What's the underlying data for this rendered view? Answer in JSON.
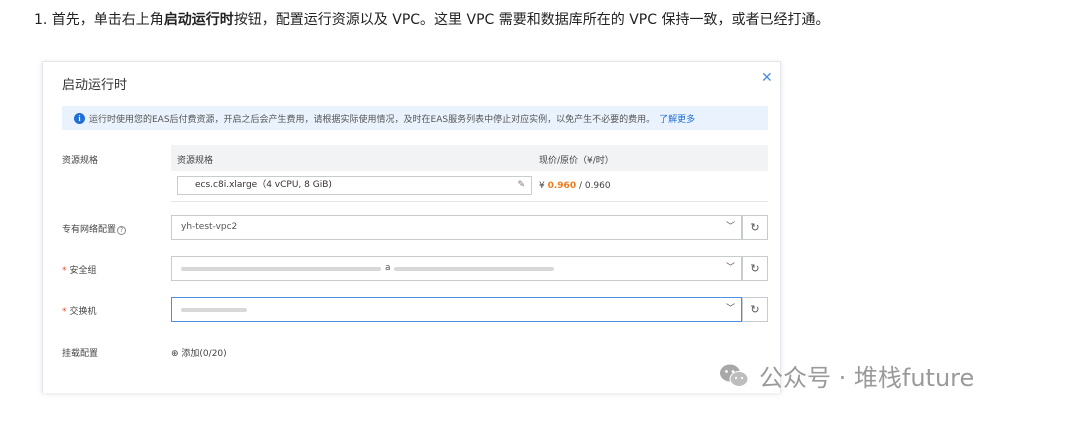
{
  "intro": {
    "prefix": "1. 首先，单击右上角",
    "bold": "启动运行时",
    "suffix": "按钮，配置运行资源以及 VPC。这里 VPC 需要和数据库所在的 VPC 保持一致，或者已经打通。"
  },
  "dialog": {
    "title": "启动运行时",
    "close_icon": "close-icon",
    "notice": {
      "icon": "info-icon",
      "text": "运行时使用您的EAS后付费资源，开启之后会产生费用，请根据实际使用情况，及时在EAS服务列表中停止对应实例，以免产生不必要的费用。",
      "link": "了解更多"
    },
    "spec": {
      "label": "资源规格",
      "col_spec": "资源规格",
      "col_price": "现价/原价（¥/时）",
      "value": "ecs.c8i.xlarge（4 vCPU, 8 GiB)",
      "price_symbol": "¥",
      "price_current": "0.960",
      "price_original": "/ 0.960"
    },
    "vpc": {
      "label": "专有网络配置",
      "value": "yh-test-vpc2"
    },
    "security_group": {
      "label": "安全组",
      "value": "a"
    },
    "vswitch": {
      "label": "交换机",
      "value": ""
    },
    "mount": {
      "label": "挂载配置",
      "add_label": "添加(0/20)"
    }
  },
  "watermark": {
    "text": "公众号 · 堆栈future"
  },
  "colors": {
    "accent": "#1f6fd6",
    "price": "#f07a1b",
    "required": "#e34d2f",
    "notice_bg": "#eaf3fd"
  }
}
